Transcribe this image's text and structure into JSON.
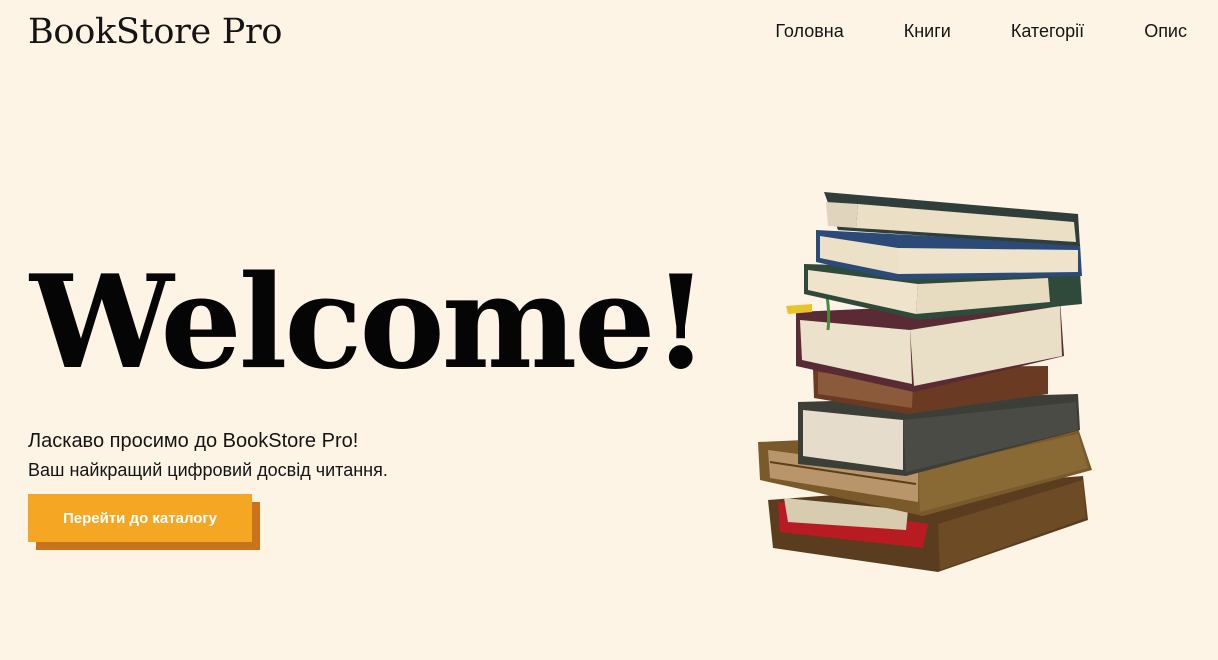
{
  "header": {
    "logo": "BookStore Pro",
    "nav": [
      "Головна",
      "Книги",
      "Категорії",
      "Опис"
    ]
  },
  "hero": {
    "title": "Welcome!",
    "subtitle": "Ласкаво просимо до BookStore Pro!",
    "tagline": "Ваш найкращий цифровий досвід читання.",
    "cta_label": "Перейти до каталогу",
    "image_icon": "book-stack-illustration"
  },
  "colors": {
    "background": "#fef4e6",
    "accent": "#f5a623",
    "accent_shadow": "#c9731f"
  }
}
